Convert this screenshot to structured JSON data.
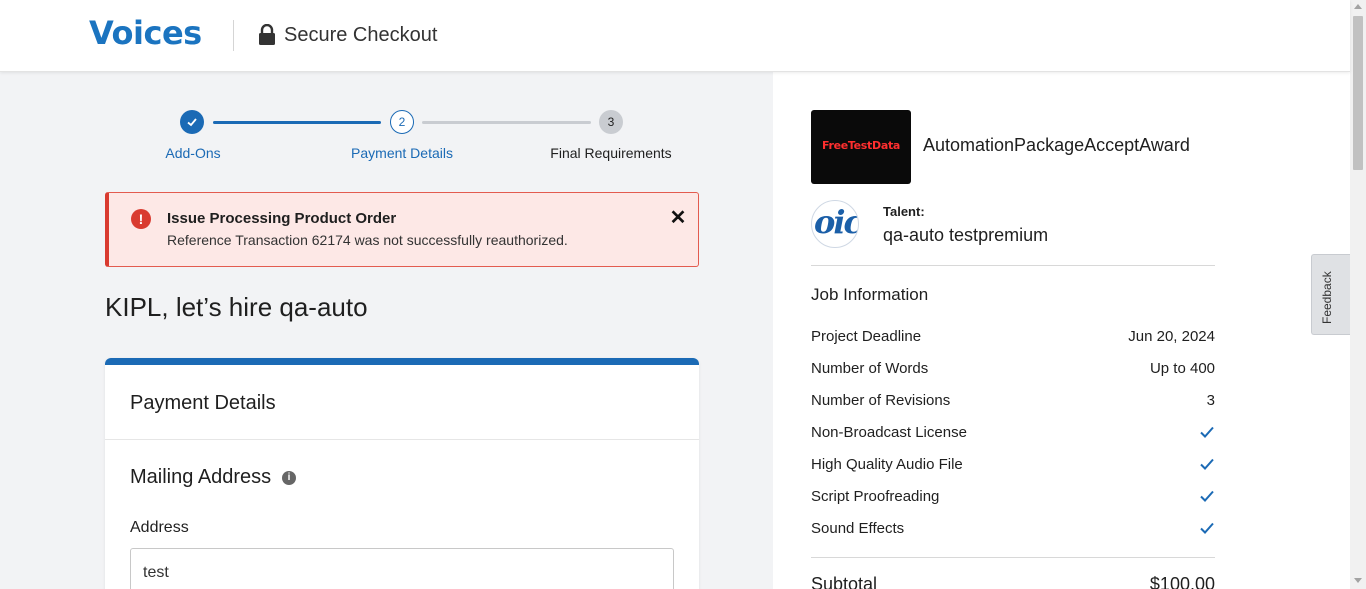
{
  "header": {
    "logo": "Voices",
    "secure_label": "Secure Checkout"
  },
  "stepper": {
    "steps": [
      {
        "label": "Add-Ons",
        "number": "",
        "state": "complete"
      },
      {
        "label": "Payment Details",
        "number": "2",
        "state": "current"
      },
      {
        "label": "Final Requirements",
        "number": "3",
        "state": "upcoming"
      }
    ]
  },
  "alert": {
    "title": "Issue Processing Product Order",
    "message": "Reference Transaction 62174 was not successfully reauthorized.",
    "icon": "!",
    "close": "✕"
  },
  "main": {
    "hire_title": "KIPL, let’s hire qa-auto",
    "card_title": "Payment Details",
    "mailing_title": "Mailing Address",
    "info_icon": "i",
    "address_label": "Address",
    "address_value": "test"
  },
  "summary": {
    "package_thumb_text": "FreeTestData",
    "package_name": "AutomationPackageAcceptAward",
    "talent_avatar_text": "oic",
    "talent_label": "Talent:",
    "talent_name": "qa-auto testpremium",
    "job_title": "Job Information",
    "rows": [
      {
        "label": "Project Deadline",
        "value": "Jun 20, 2024"
      },
      {
        "label": "Number of Words",
        "value": "Up to 400"
      },
      {
        "label": "Number of Revisions",
        "value": "3"
      },
      {
        "label": "Non-Broadcast License",
        "value": ""
      },
      {
        "label": "High Quality Audio File",
        "value": ""
      },
      {
        "label": "Script Proofreading",
        "value": ""
      },
      {
        "label": "Sound Effects",
        "value": ""
      }
    ],
    "subtotal_label": "Subtotal",
    "subtotal_value": "$100.00"
  },
  "feedback": "Feedback",
  "colors": {
    "brand_blue": "#1b74c0",
    "step_blue": "#1b6ab5",
    "error_red": "#d93b30"
  }
}
